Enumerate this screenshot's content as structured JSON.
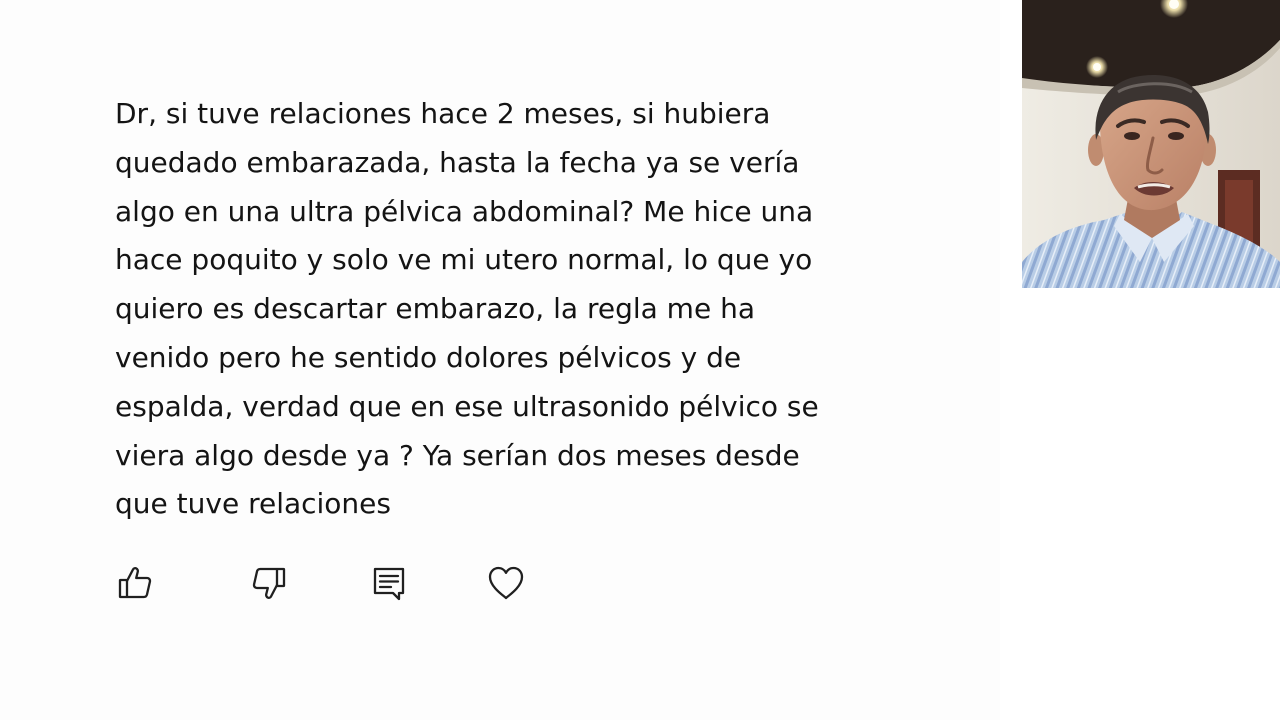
{
  "comment": {
    "lines": [
      "Dr, si tuve relaciones hace 2 meses, si hubiera",
      "quedado embarazada, hasta la fecha ya se vería",
      "algo en una ultra pélvica abdominal? Me hice una",
      "hace poquito y solo ve mi utero normal, lo que yo",
      "quiero es descartar embarazo, la regla me ha",
      "venido pero he sentido dolores pélvicos y de",
      "espalda, verdad que en ese ultrasonido pélvico se",
      "viera algo desde ya ? Ya serían dos meses desde",
      "que tuve relaciones"
    ]
  },
  "actions": {
    "like_icon": "thumbs-up-icon",
    "dislike_icon": "thumbs-down-icon",
    "reply_icon": "reply-comment-icon",
    "heart_icon": "heart-icon"
  },
  "colors": {
    "text": "#141414",
    "icon_stroke": "#202020",
    "background": "#fdfdfd"
  }
}
